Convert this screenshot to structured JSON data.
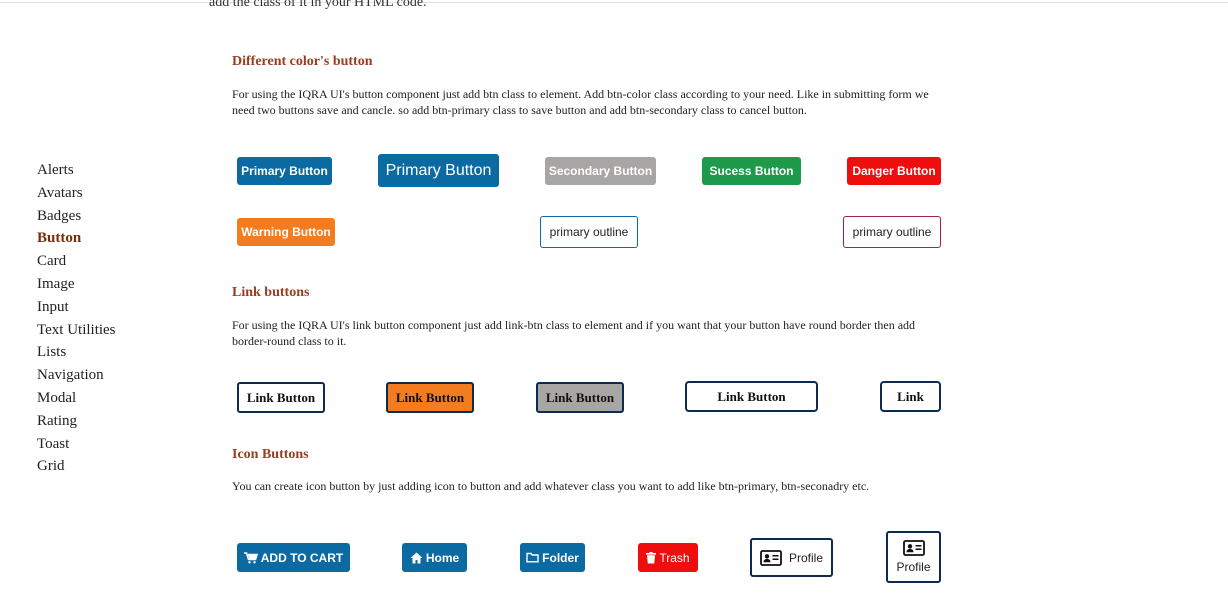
{
  "intro_cut": "add the class of it in your HTML code.",
  "sidebar": {
    "items": [
      {
        "label": "Alerts"
      },
      {
        "label": "Avatars"
      },
      {
        "label": "Badges"
      },
      {
        "label": "Button"
      },
      {
        "label": "Card"
      },
      {
        "label": "Image"
      },
      {
        "label": "Input"
      },
      {
        "label": "Text Utilities"
      },
      {
        "label": "Lists"
      },
      {
        "label": "Navigation"
      },
      {
        "label": "Modal"
      },
      {
        "label": "Rating"
      },
      {
        "label": "Toast"
      },
      {
        "label": "Grid"
      }
    ],
    "active": "Button"
  },
  "sections": {
    "colors": {
      "title": "Different color's button",
      "desc": "For using the IQRA UI's button component just add btn class to element. Add btn-color class according to your need. Like in submitting form we need two buttons save and cancle. so add btn-primary class to save button and add btn-secondary class to cancel button.",
      "buttons": {
        "primary": "Primary Button",
        "primary_large": "Primary Button",
        "secondary": "Secondary Button",
        "success": "Sucess Button",
        "danger": "Danger Button",
        "warning": "Warning Button",
        "outline_primary": "primary outline",
        "outline_danger": "primary outline"
      }
    },
    "links": {
      "title": "Link buttons",
      "desc": "For using the IQRA UI's link button component just add link-btn class to element and if you want that your button have round border then add border-round class to it.",
      "buttons": [
        "Link Button",
        "Link Button",
        "Link Button",
        "Link Button",
        "Link"
      ]
    },
    "icons": {
      "title": "Icon Buttons",
      "desc": "You can create icon button by just adding icon to button and add whatever class you want to add like btn-primary, btn-seconadry etc.",
      "buttons": {
        "cart": "ADD TO CART",
        "home": "Home",
        "folder": "Folder",
        "trash": "Trash",
        "profile": "Profile",
        "profile_stacked": "Profile"
      }
    }
  },
  "colors": {
    "primary": "#0b6aa2",
    "secondary": "#a8a5a5",
    "success": "#1e9a4a",
    "danger": "#ee0e0e",
    "warning": "#f57b1f",
    "heading": "#9a3d1f",
    "active_nav": "#7a2e0e",
    "dark_border": "#0c2b4f"
  }
}
